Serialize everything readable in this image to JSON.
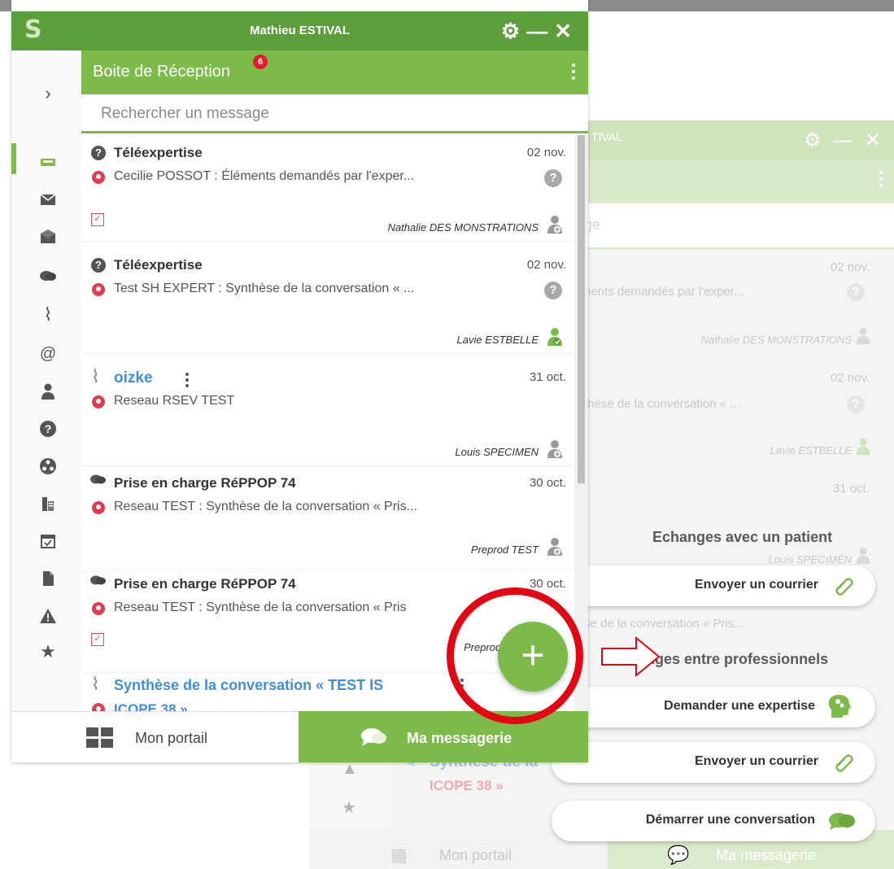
{
  "main_window": {
    "user_name": "Mathieu ESTIVAL",
    "inbox_title": "Boite de Réception",
    "unread_count": "6",
    "search_placeholder": "Rechercher un message",
    "messages": [
      {
        "title": "Téléexpertise",
        "date": "02 nov.",
        "subtitle": "Cecilie POSSOT : Éléments demandés par l'exper...",
        "sender": "Nathalie DES MONSTRATIONS"
      },
      {
        "title": "Téléexpertise",
        "date": "02 nov.",
        "subtitle": "Test SH EXPERT : Synthèse de la conversation « ...",
        "sender": "Lavie ESTBELLE"
      },
      {
        "title": "oizke",
        "date": "31 oct.",
        "subtitle": "Reseau RSEV TEST",
        "sender": "Louis SPECIMEN"
      },
      {
        "title": "Prise en charge RéPPOP 74",
        "date": "30 oct.",
        "subtitle": "Reseau TEST : Synthèse de la conversation « Pris...",
        "sender": "Preprod TEST"
      },
      {
        "title": "Prise en charge RéPPOP 74",
        "date": "30 oct.",
        "subtitle": "Reseau TEST : Synthèse de la conversation « Pris",
        "sender": "Preprod"
      },
      {
        "title": "Synthèse de la conversation « TEST IS",
        "subtitle": "ICOPE 38 »"
      }
    ],
    "footer": {
      "portail": "Mon portail",
      "messagerie": "Ma messagerie"
    }
  },
  "background_window": {
    "title_fragment": "TIVAL",
    "search_fragment": "ge",
    "items": [
      {
        "date": "02 nov.",
        "subtitle": "nents demandés par l'exper...",
        "sender": "Nathalie DES MONSTRATIONS"
      },
      {
        "date": "02 nov.",
        "subtitle": "thèse de la conversation « ...",
        "sender": "Lavie ESTBELLE"
      },
      {
        "date": "31 oct.",
        "sender": "Louis SPECIMEN"
      }
    ],
    "faded_line": "se de la conversation « Pris...",
    "faded_title": "Synthèse de la",
    "faded_sub": "ICOPE 38 »",
    "footer_portail": "Mon portail",
    "footer_messagerie": "Ma messagerie"
  },
  "action_panel": {
    "patient_section": "Echanges avec un patient",
    "patient_send_mail": "Envoyer un courrier",
    "pro_section": "Echanges entre professionnels",
    "request_expertise": "Demander une expertise",
    "pro_send_mail": "Envoyer un courrier",
    "start_conversation": "Démarrer une conversation"
  },
  "colors": {
    "brand_green": "#7cba4a",
    "header_green": "#5d9e3c",
    "badge_red": "#e8172d",
    "link_blue": "#3e8ede",
    "highlight_red": "#e30613"
  },
  "icons": {
    "sidebar": [
      "chevron-right-icon",
      "inbox-icon",
      "envelope-icon",
      "envelope-open-icon",
      "chat-icon",
      "paperclip-icon",
      "at-icon",
      "user-icon",
      "question-icon",
      "network-icon",
      "building-icon",
      "calendar-check-icon",
      "file-icon",
      "warning-icon",
      "star-icon"
    ]
  }
}
